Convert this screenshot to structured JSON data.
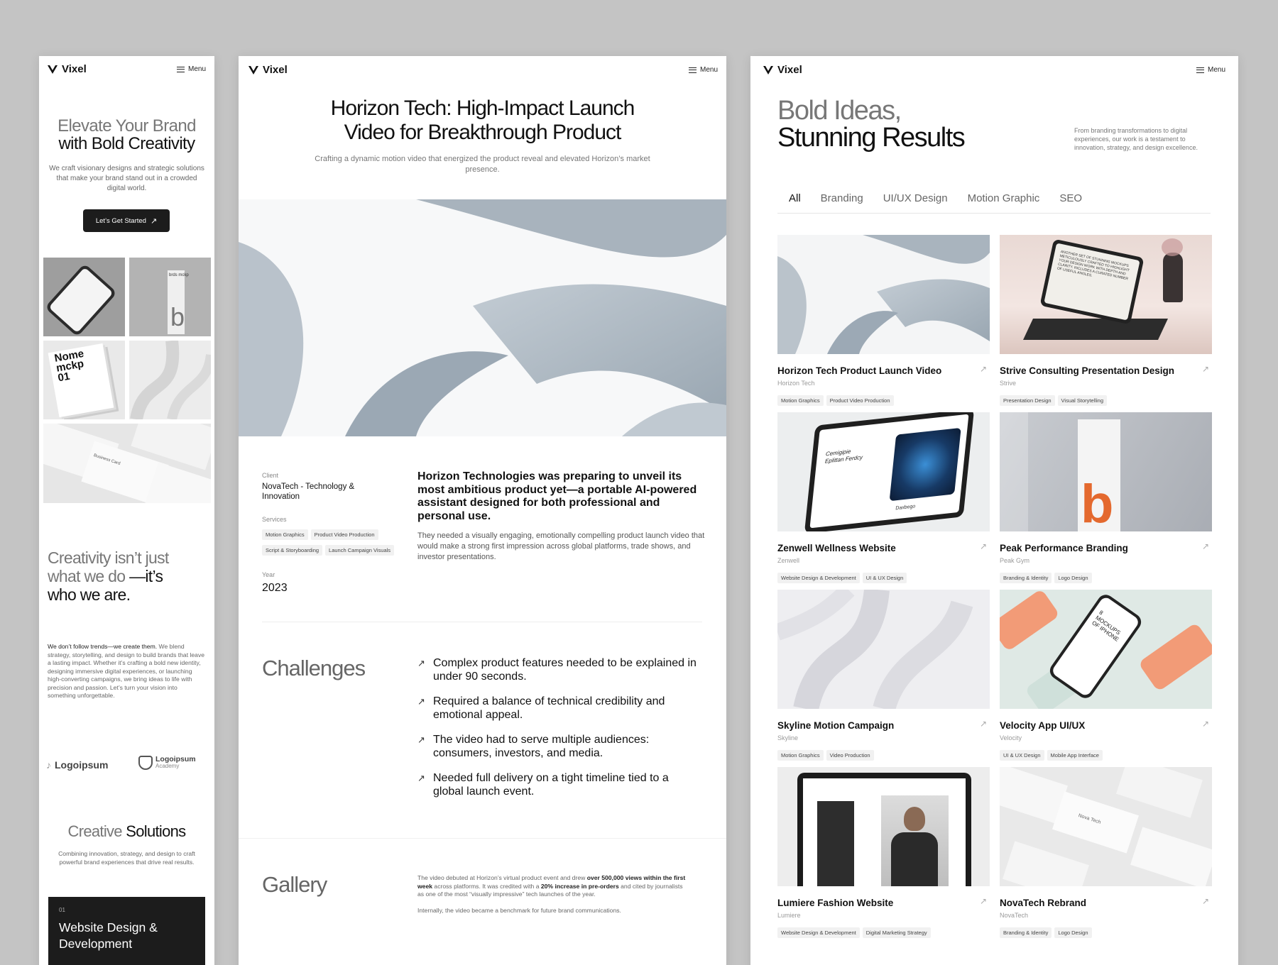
{
  "brand": {
    "name": "Vixel",
    "menu_label": "Menu"
  },
  "mobile": {
    "hero_title_1": "Elevate Your Brand",
    "hero_title_2": "with Bold Creativity",
    "hero_text": "We craft visionary designs and strategic solutions that make your brand stand out in a crowded digital world.",
    "cta_label": "Let’s Get Started",
    "mock_nome": "Nome mckp 01",
    "mock_brds": "brds mckp",
    "mock_card": "Business Card",
    "about_title_1": "Creativity isn’t just",
    "about_title_2": "what we do",
    "about_title_3": "—it’s",
    "about_title_4": "who we are.",
    "about_lead": "We don’t follow trends—we create them.",
    "about_text": "We blend strategy, storytelling, and design to build brands that leave a lasting impact. Whether it’s crafting a bold new identity, designing immersive digital experiences, or launching high-converting campaigns, we bring ideas to life with precision and passion. Let’s turn your vision into something unforgettable.",
    "logos": [
      "Logoipsum",
      "Logoipsum",
      "Academy"
    ],
    "solutions_title_1": "Creative",
    "solutions_title_2": "Solutions",
    "solutions_text": "Combining innovation, strategy, and design to craft powerful brand experiences that drive real results.",
    "service_num": "01",
    "service_title": "Website Design & Development"
  },
  "case": {
    "title": "Horizon Tech: High-Impact Launch Video for Breakthrough Product",
    "subtitle": "Crafting a dynamic motion video that energized the product reveal and elevated Horizon’s market presence.",
    "client_label": "Client",
    "client_value": "NovaTech - Technology & Innovation",
    "services_label": "Services",
    "services": [
      "Motion Graphics",
      "Product Video Production",
      "Script & Storyboarding",
      "Launch Campaign Visuals"
    ],
    "year_label": "Year",
    "year_value": "2023",
    "intro_lead": "Horizon Technologies was preparing to unveil its most ambitious product yet—a portable AI-powered assistant designed for both professional and personal use.",
    "intro_text": "They needed a visually engaging, emotionally compelling product launch video that would make a strong first impression across global platforms, trade shows, and investor presentations.",
    "challenges_title": "Challenges",
    "challenges": [
      "Complex product features needed to be explained in under 90 seconds.",
      "Required a balance of technical credibility and emotional appeal.",
      "The video had to serve multiple audiences: consumers, investors, and media.",
      "Needed full delivery on a tight timeline tied to a global launch event."
    ],
    "gallery_title": "Gallery",
    "gallery_p1_a": "The video debuted at Horizon’s virtual product event and drew ",
    "gallery_p1_b": "over 500,000 views within the first week",
    "gallery_p1_c": " across platforms. It was credited with a ",
    "gallery_p1_d": "20% increase in pre-orders",
    "gallery_p1_e": " and cited by journalists as one of the most “visually impressive” tech launches of the year.",
    "gallery_p2": "Internally, the video became a benchmark for future brand communications."
  },
  "portfolio": {
    "title_1": "Bold Ideas,",
    "title_2": "Stunning Results",
    "intro": "From branding transformations to digital experiences, our work is a testament to innovation, strategy, and design excellence.",
    "filters": [
      "All",
      "Branding",
      "UI/UX Design",
      "Motion Graphic",
      "SEO"
    ],
    "tablet_text_1": "Cemigipie",
    "tablet_text_2": "Eplittan Ferdcy",
    "tablet_text_3": "Daxbego",
    "laptop_text": "ANOTHER SET OF STUNNING MOCKUPS METICULOUSLY CRAFTED TO HIGHLIGHT YOUR DESIGN WORK WITH DEPTH AND CLARITY. INCLUDES A CURATED NUMBER OF USEFUL ANGLES.",
    "phone_text": "8 MOCKUPS OF IPHONE",
    "nova_text": "Nova Tech",
    "projects": [
      {
        "title": "Horizon Tech Product Launch Video",
        "client": "Horizon Tech",
        "tags": [
          "Motion Graphics",
          "Product Video Production"
        ]
      },
      {
        "title": "Strive Consulting Presentation Design",
        "client": "Strive",
        "tags": [
          "Presentation Design",
          "Visual Storytelling"
        ]
      },
      {
        "title": "Zenwell Wellness Website",
        "client": "Zenwell",
        "tags": [
          "Website Design & Development",
          "UI & UX Design"
        ]
      },
      {
        "title": "Peak Performance Branding",
        "client": "Peak Gym",
        "tags": [
          "Branding & Identity",
          "Logo Design"
        ]
      },
      {
        "title": "Skyline Motion Campaign",
        "client": "Skyline",
        "tags": [
          "Motion Graphics",
          "Video Production"
        ]
      },
      {
        "title": "Velocity App UI/UX",
        "client": "Velocity",
        "tags": [
          "UI & UX Design",
          "Mobile App Interface"
        ]
      },
      {
        "title": "Lumiere Fashion Website",
        "client": "Lumiere",
        "tags": [
          "Website Design & Development",
          "Digital Marketing Strategy"
        ]
      },
      {
        "title": "NovaTech Rebrand",
        "client": "NovaTech",
        "tags": [
          "Branding & Identity",
          "Logo Design"
        ]
      }
    ]
  }
}
